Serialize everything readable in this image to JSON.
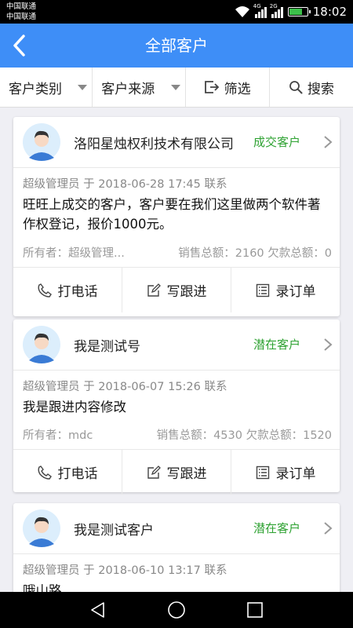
{
  "status_bar": {
    "carrier_1": "中国联通",
    "carrier_2": "中国联通",
    "net_1": "4G",
    "net_2": "2G",
    "time": "18:02",
    "battery_level": 0.8
  },
  "header": {
    "title": "全部客户",
    "back_icon": "chevron-left-icon"
  },
  "filters": {
    "category": "客户类别",
    "source": "客户来源",
    "filter": "筛选",
    "search": "搜索"
  },
  "colors": {
    "primary": "#3e8ef7",
    "status_green": "#2ea232"
  },
  "actions": {
    "call": "打电话",
    "followup": "写跟进",
    "order": "录订单"
  },
  "customers": [
    {
      "name": "洛阳星烛权利技术有限公司",
      "status": "成交客户",
      "meta": "超级管理员 于 2018-06-28 17:45 联系",
      "content": "旺旺上成交的客户，客户要在我们这里做两个软件著作权登记，报价1000元。",
      "owner": "所有者：超级管理...",
      "sales": "销售总额：2160  欠款总额：0"
    },
    {
      "name": "我是测试号",
      "status": "潜在客户",
      "meta": "超级管理员 于 2018-06-07 15:26 联系",
      "content": "我是跟进内容修改",
      "owner": "所有者：mdc",
      "sales": "销售总额：4530  欠款总额：1520"
    },
    {
      "name": "我是测试客户",
      "status": "潜在客户",
      "meta": "超级管理员 于 2018-06-10 13:17 联系",
      "content": "哦山路"
    }
  ]
}
